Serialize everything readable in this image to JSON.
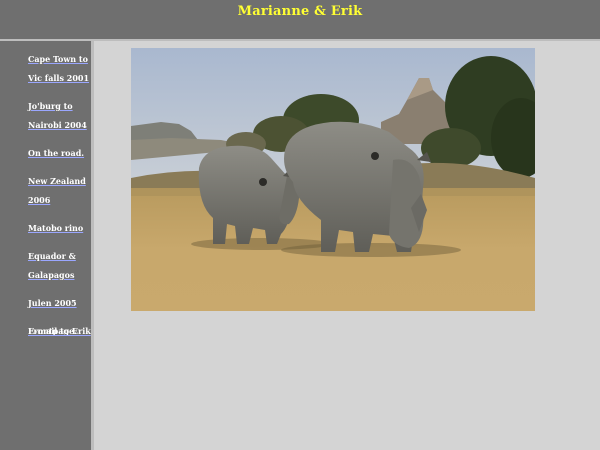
{
  "header": {
    "title": "Marianne & Erik"
  },
  "sidebar": {
    "items": [
      {
        "label": "Cape Town to\nVic falls 2001"
      },
      {
        "label": "Jo'burg to\nNairobi 2004"
      },
      {
        "label": "On the road."
      },
      {
        "label": "New Zealand\n2006"
      },
      {
        "label": "Matobo rino"
      },
      {
        "label": "Equador &\nGalapagos"
      },
      {
        "label": "Julen 2005"
      },
      {
        "label": "Frontpage."
      }
    ],
    "email_label": "E-mail to Erik"
  },
  "main": {
    "photo": {
      "subject": "two-rhinos-grazing-photo"
    }
  },
  "colors": {
    "header_bg": "#6f6f6f",
    "title_text": "#ffff33",
    "link_text": "#ffffff",
    "content_bg": "#d4d4d4"
  }
}
